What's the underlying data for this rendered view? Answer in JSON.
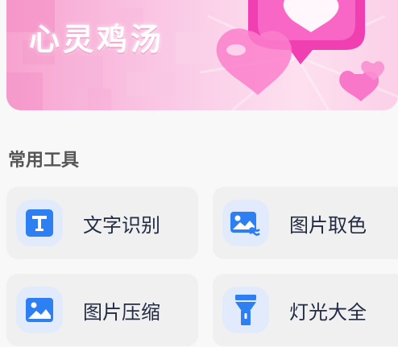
{
  "banner": {
    "title": "心灵鸡汤"
  },
  "section": {
    "title": "常用工具"
  },
  "tools": [
    {
      "label": "文字识别",
      "icon": "text-recognition-icon"
    },
    {
      "label": "图片取色",
      "icon": "image-color-picker-icon"
    },
    {
      "label": "图片压缩",
      "icon": "image-compress-icon"
    },
    {
      "label": "灯光大全",
      "icon": "flashlight-icon"
    }
  ],
  "colors": {
    "accent": "#2d7ff2",
    "icon_bg": "#e2ebfb",
    "banner_pink": "#f7a2cf",
    "heart_magenta": "#ef3fb0"
  }
}
